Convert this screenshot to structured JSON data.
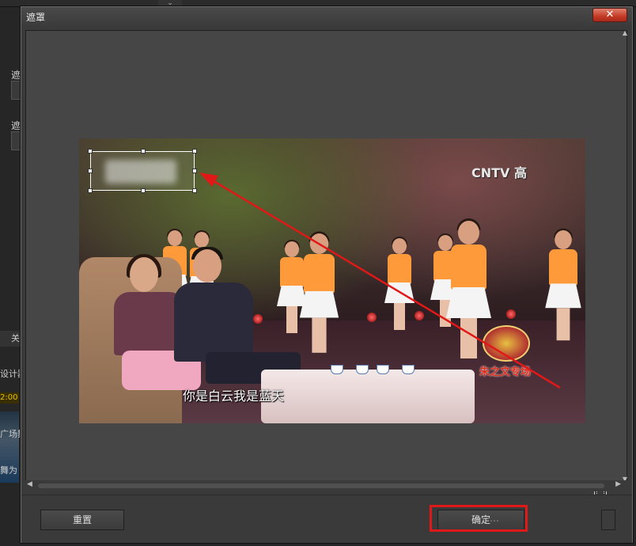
{
  "background_app": {
    "dropdown_glyph": "⌄",
    "label_1": "遮",
    "label_2": "遮",
    "tab_label": "关",
    "text_design": "设计器",
    "time_value": "2:00",
    "text_scene": "广场舞",
    "text_dance": "舞为"
  },
  "dialog": {
    "title": "遮罩",
    "close_glyph": "✕",
    "scroll_up": "▲",
    "scroll_down": "▼",
    "scroll_left": "◀",
    "scroll_right": "▶",
    "video": {
      "channel_logo": "CNTV 高",
      "subtitle": "你是白云我是蓝天",
      "show_logo_text": "朱之文专场"
    },
    "buttons": {
      "reset": "重置",
      "ok": "确定",
      "watermark": "…"
    }
  },
  "colors": {
    "highlight_red": "#e01818",
    "close_red": "#c43b25",
    "dancer_orange": "#ff9a3a"
  }
}
